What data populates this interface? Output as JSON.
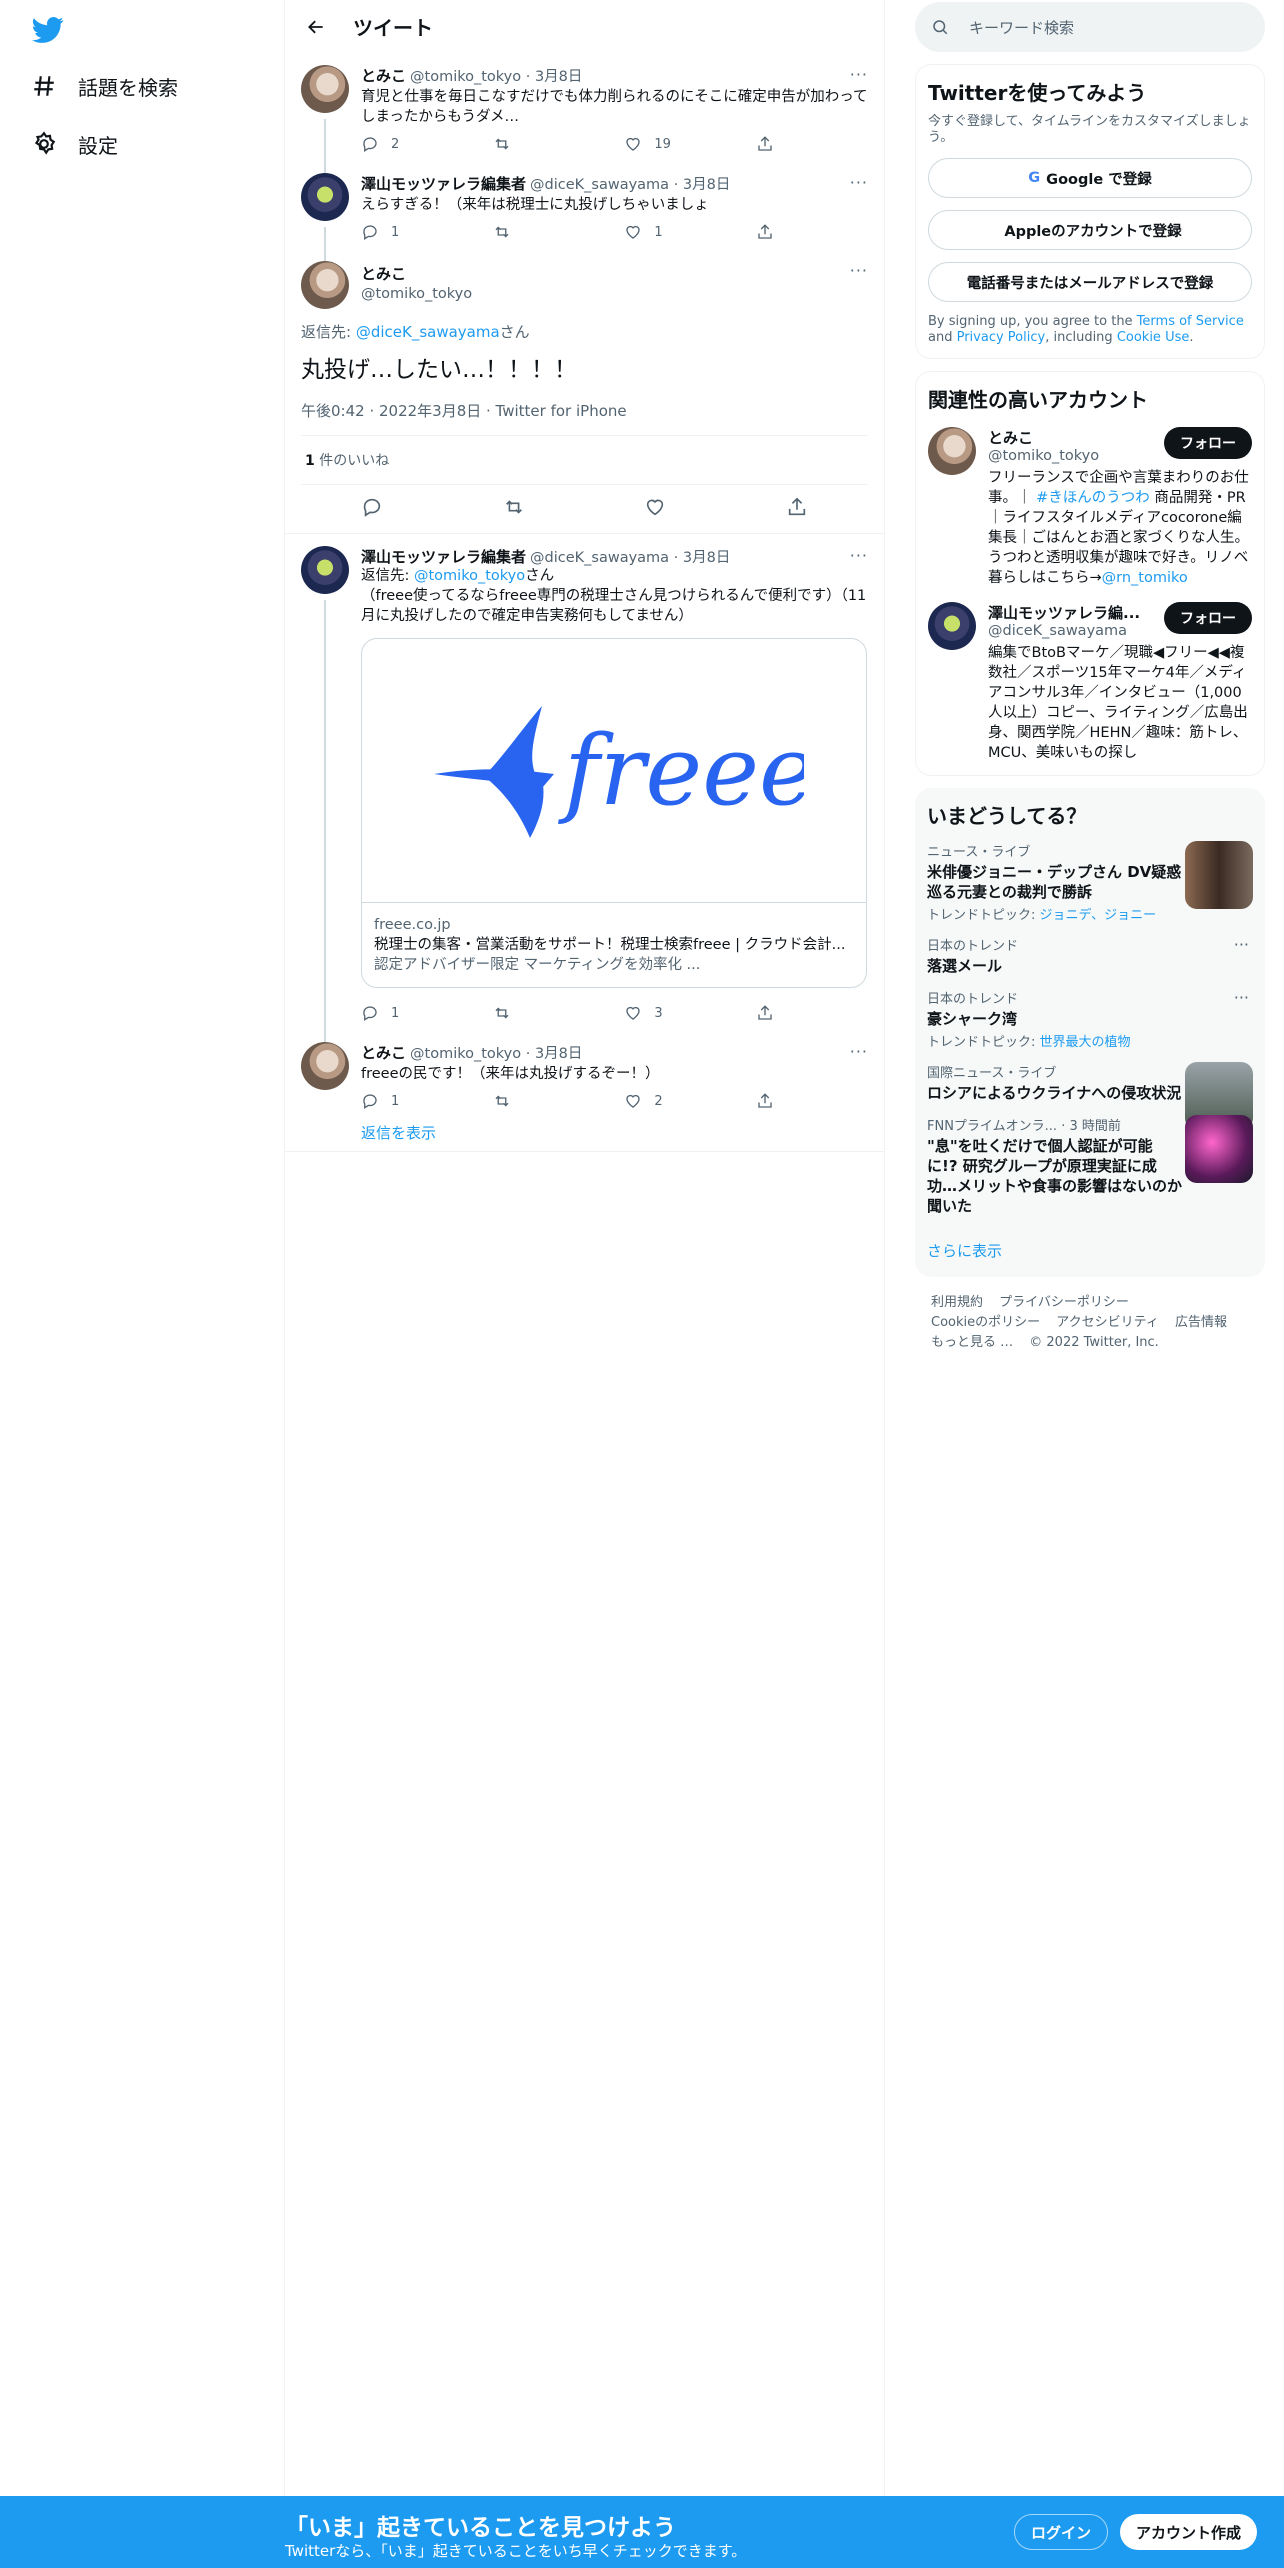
{
  "nav": {
    "logo_icon": "twitter-bird-icon",
    "items": [
      {
        "label": "話題を検索",
        "icon": "hashtag-icon"
      },
      {
        "label": "設定",
        "icon": "gear-icon"
      }
    ]
  },
  "header": {
    "title": "ツイート"
  },
  "tweets": [
    {
      "name": "とみこ",
      "handle": "@tomiko_tokyo · 3月8日",
      "text": "育児と仕事を毎日こなすだけでも体力削られるのにそこに確定申告が加わってしまったからもうダメ…",
      "reply": "2",
      "retweet": "",
      "like": "19"
    },
    {
      "name": "澤山モッツァレラ編集者",
      "handle": "@diceK_sawayama · 3月8日",
      "text": "えらすぎる！（来年は税理士に丸投げしちゃいましょ",
      "reply": "1",
      "retweet": "",
      "like": "1"
    }
  ],
  "focus": {
    "name": "とみこ",
    "handle": "@tomiko_tokyo",
    "reply_prefix": "返信先: ",
    "reply_handle": "@diceK_sawayama",
    "reply_suffix": "さん",
    "text": "丸投げ…したい…！！！！",
    "meta": "午後0:42 · 2022年3月8日 · Twitter for iPhone",
    "likes_count": "1",
    "likes_label": " 件のいいね"
  },
  "reply1": {
    "name": "澤山モッツァレラ編集者",
    "handle": "@diceK_sawayama · 3月8日",
    "reply_prefix": "返信先: ",
    "reply_handle": "@tomiko_tokyo",
    "reply_suffix": "さん",
    "text": "（freee使ってるならfreee専門の税理士さん見つけられるんで便利です）（11月に丸投げしたので確定申告実務何もしてません）",
    "card": {
      "logo_text": "freee",
      "domain": "freee.co.jp",
      "title": "税理士の集客・営業活動をサポート！税理士検索freee | クラウド会計...",
      "desc": "認定アドバイザー限定 マーケティングを効率化 ..."
    },
    "reply": "1",
    "retweet": "",
    "like": "3"
  },
  "reply2": {
    "name": "とみこ",
    "handle": "@tomiko_tokyo · 3月8日",
    "text": "freeeの民です！（来年は丸投げするぞー！）",
    "reply": "1",
    "retweet": "",
    "like": "2",
    "show_replies": "返信を表示"
  },
  "search": {
    "placeholder": "キーワード検索"
  },
  "signup": {
    "title": "Twitterを使ってみよう",
    "subtitle": "今すぐ登録して、タイムラインをカスタマイズしましょう。",
    "google": "Google で登録",
    "apple": "Appleのアカウントで登録",
    "phone": "電話番号またはメールアドレスで登録",
    "terms_a": "By signing up, you agree to the ",
    "terms_link1": "Terms of Service",
    "terms_b": " and ",
    "terms_link2": "Privacy Policy",
    "terms_c": ", including ",
    "terms_link3": "Cookie Use",
    "terms_d": "."
  },
  "related": {
    "title": "関連性の高いアカウント",
    "accounts": [
      {
        "name": "とみこ",
        "handle": "@tomiko_tokyo",
        "follow": "フォロー",
        "bio_a": "フリーランスで企画や言葉まわりのお仕事。｜ ",
        "bio_tag": "#きほんのうつわ",
        "bio_b": " 商品開発・PR｜ライフスタイルメディアcocorone編集長｜ごはんとお酒と家づくりな人生。うつわと透明収集が趣味で好き。リノベ暮らしはこちら→",
        "bio_link": "@rn_tomiko"
      },
      {
        "name": "澤山モッツァレラ編...",
        "handle": "@diceK_sawayama",
        "follow": "フォロー",
        "bio_a": "編集でBtoBマーケ／現職◀フリー◀◀複数社／スポーツ15年マーケ4年／メディアコンサル3年／インタビュー（1,000人以上）コピー、ライティング／広島出身、関西学院／HEHN／趣味：筋トレ、MCU、美味いもの探し",
        "bio_tag": "",
        "bio_b": "",
        "bio_link": ""
      }
    ]
  },
  "trends": {
    "title": "いまどうしてる？",
    "items": [
      {
        "cat": "ニュース・ライブ",
        "title": "米俳優ジョニー・デップさん DV疑惑巡る元妻との裁判で勝訴",
        "sub_a": "トレンドトピック: ",
        "sub_link": "ジョニデ、ジョニー"
      },
      {
        "cat": "日本のトレンド",
        "title": "落選メール",
        "sub_a": "",
        "sub_link": ""
      },
      {
        "cat": "日本のトレンド",
        "title": "豪シャーク湾",
        "sub_a": "トレンドトピック: ",
        "sub_link": "世界最大の植物"
      },
      {
        "cat": "国際ニュース・ライブ",
        "title": "ロシアによるウクライナへの侵攻状況",
        "sub_a": "",
        "sub_link": ""
      },
      {
        "cat": "FNNプライムオンラ... · 3 時間前",
        "title": "\"息\"を吐くだけで個人認証が可能に!? 研究グループが原理実証に成功…メリットや食事の影響はないのか聞いた",
        "sub_a": "",
        "sub_link": ""
      }
    ],
    "more": "さらに表示"
  },
  "footer": {
    "links": [
      "利用規約",
      "プライバシーポリシー",
      "Cookieのポリシー",
      "アクセシビリティ",
      "広告情報",
      "もっと見る …",
      "© 2022 Twitter, Inc."
    ]
  },
  "bottom": {
    "headline": "「いま」起きていることを見つけよう",
    "sub": "Twitterなら、「いま」起きていることをいち早くチェックできます。",
    "login": "ログイン",
    "signup": "アカウント作成"
  },
  "colors": {
    "accent": "#1d9bf0",
    "text": "#0f1419",
    "muted": "#536471",
    "border": "#eff3f4",
    "freee_blue": "#2864f0"
  }
}
